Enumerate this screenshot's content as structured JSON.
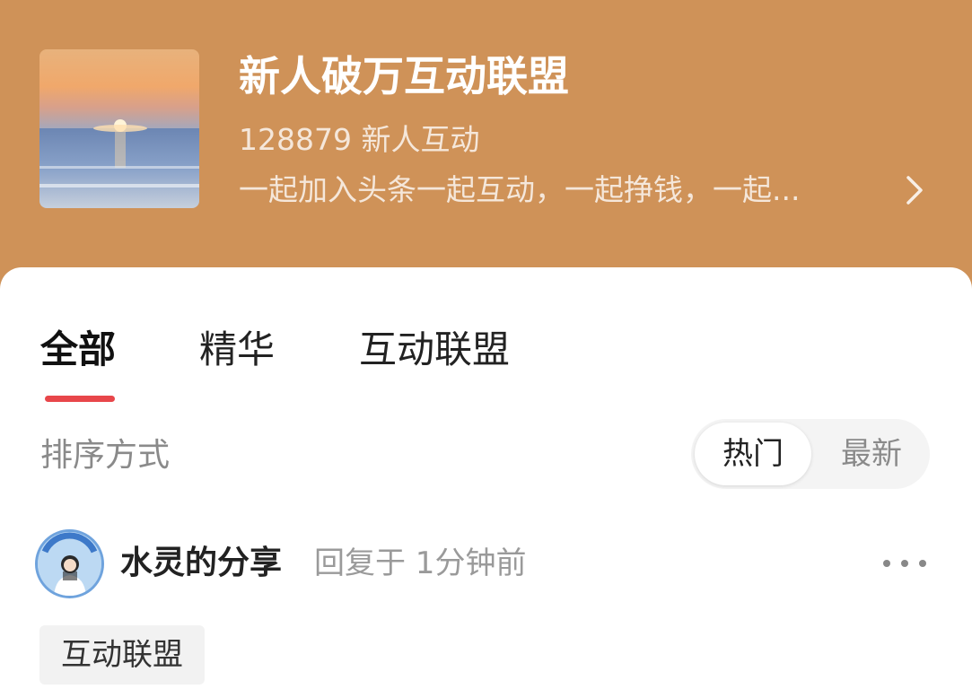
{
  "group": {
    "title": "新人破万互动联盟",
    "stats": "128879 新人互动",
    "description": "一起加入头条一起互动，一起挣钱，一起...",
    "cover_icon": "sunset-over-sea-image",
    "background_color": "#cf9258"
  },
  "tabs": [
    {
      "label": "全部",
      "active": true
    },
    {
      "label": "精华",
      "active": false
    },
    {
      "label": "互动联盟",
      "active": false
    }
  ],
  "sort": {
    "label": "排序方式",
    "options": [
      "热门",
      "最新"
    ],
    "selected": "热门"
  },
  "post": {
    "author": "水灵的分享",
    "meta": "回复于 1分钟前",
    "tag": "互动联盟",
    "more_icon": "more-dots-icon"
  },
  "accent_color": "#e8464a"
}
